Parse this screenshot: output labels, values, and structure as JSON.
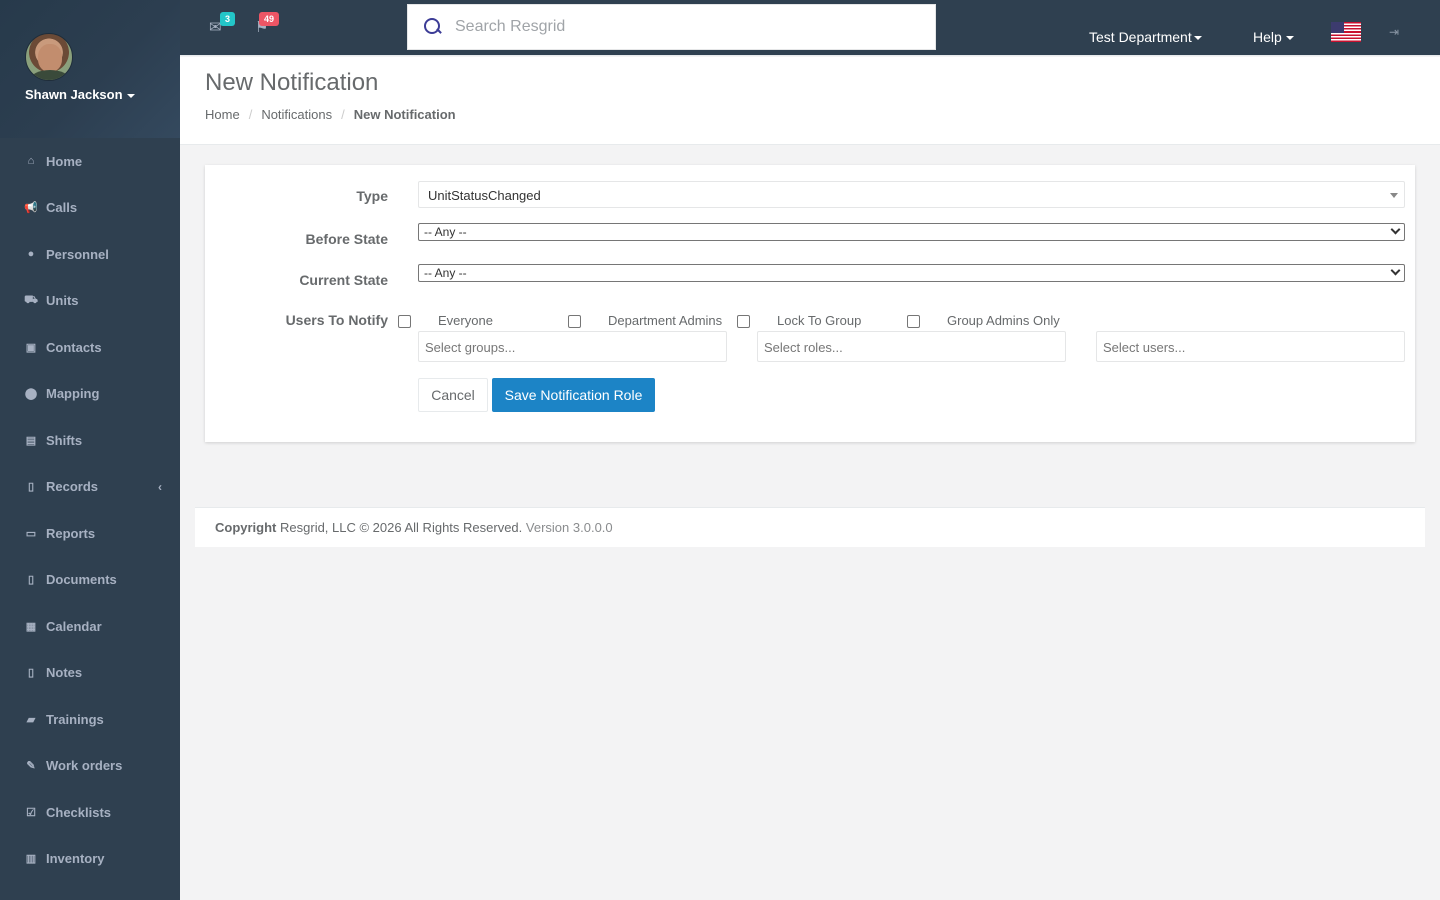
{
  "user": {
    "name": "Shawn Jackson"
  },
  "sidebar": {
    "items": [
      {
        "label": "Home",
        "icon": "home-icon",
        "glyph": "⌂"
      },
      {
        "label": "Calls",
        "icon": "bullhorn-icon",
        "glyph": "📢"
      },
      {
        "label": "Personnel",
        "icon": "user-icon",
        "glyph": "●"
      },
      {
        "label": "Units",
        "icon": "truck-icon",
        "glyph": "⛟"
      },
      {
        "label": "Contacts",
        "icon": "address-book-icon",
        "glyph": "▣"
      },
      {
        "label": "Mapping",
        "icon": "map-marker-icon",
        "glyph": "⬤"
      },
      {
        "label": "Shifts",
        "icon": "briefcase-icon",
        "glyph": "▤"
      },
      {
        "label": "Records",
        "icon": "file-icon",
        "glyph": "▯"
      },
      {
        "label": "Reports",
        "icon": "copy-icon",
        "glyph": "▭"
      },
      {
        "label": "Documents",
        "icon": "file-text-icon",
        "glyph": "▯"
      },
      {
        "label": "Calendar",
        "icon": "calendar-icon",
        "glyph": "▦"
      },
      {
        "label": "Notes",
        "icon": "files-icon",
        "glyph": "▯"
      },
      {
        "label": "Trainings",
        "icon": "book-icon",
        "glyph": "▰"
      },
      {
        "label": "Work orders",
        "icon": "wrench-icon",
        "glyph": "✎"
      },
      {
        "label": "Checklists",
        "icon": "check-square-icon",
        "glyph": "☑"
      },
      {
        "label": "Inventory",
        "icon": "barcode-icon",
        "glyph": "▥"
      }
    ]
  },
  "topbar": {
    "messages_count": "3",
    "calls_count": "49",
    "search_placeholder": "Search Resgrid",
    "department": "Test Department",
    "help": "Help",
    "badge_colors": {
      "messages": "#23c6c8",
      "calls": "#ed5565"
    }
  },
  "page": {
    "title": "New Notification",
    "breadcrumb": [
      "Home",
      "Notifications",
      "New Notification"
    ]
  },
  "form": {
    "type_label": "Type",
    "type_value": "UnitStatusChanged",
    "before_state_label": "Before State",
    "before_state_value": "-- Any --",
    "current_state_label": "Current State",
    "current_state_value": "-- Any --",
    "users_label": "Users To Notify",
    "options": [
      "Everyone",
      "Department Admins",
      "Lock To Group",
      "Group Admins Only"
    ],
    "groups_placeholder": "Select groups...",
    "roles_placeholder": "Select roles...",
    "users_placeholder": "Select users...",
    "cancel": "Cancel",
    "save": "Save Notification Role"
  },
  "footer": {
    "copyright_bold": "Copyright",
    "copyright_text": "Resgrid, LLC © 2026 All Rights Reserved.",
    "version": "Version 3.0.0.0"
  }
}
